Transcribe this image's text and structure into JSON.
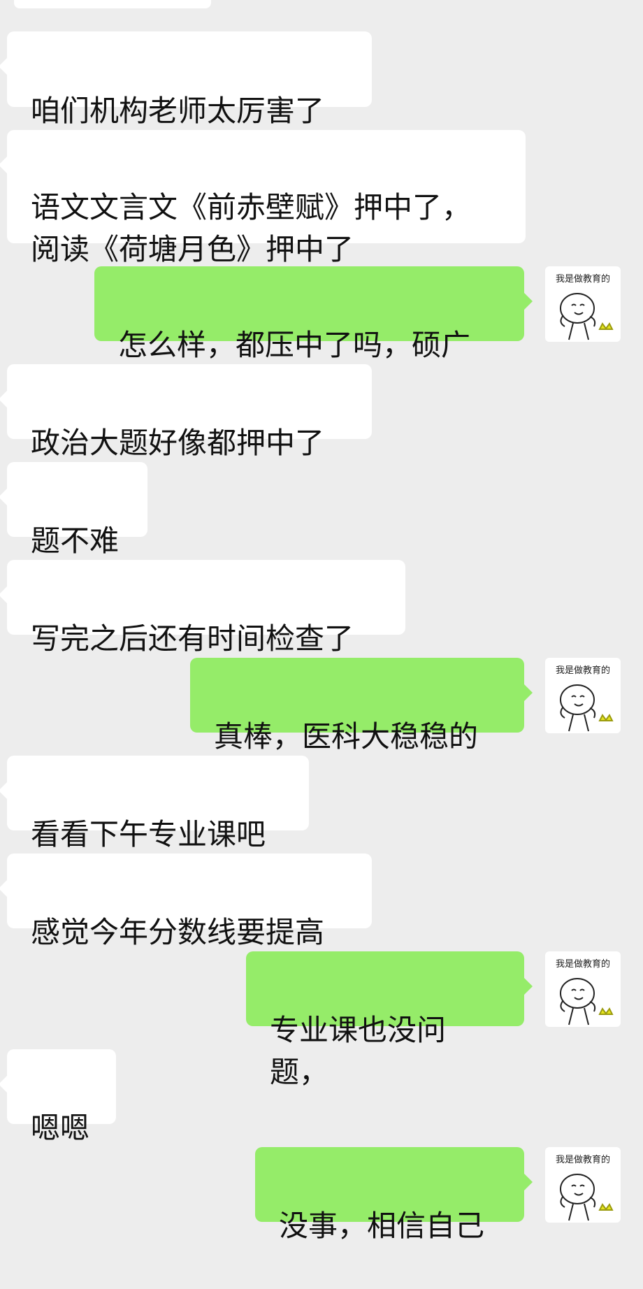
{
  "chat": {
    "messages": [
      {
        "side": "left",
        "text": "咱们机构老师太厉害了"
      },
      {
        "side": "left",
        "text": "语文文言文《前赤壁赋》押中了，\n阅读《荷塘月色》押中了"
      },
      {
        "side": "right",
        "text": "怎么样，都压中了吗，硕广"
      },
      {
        "side": "left",
        "text": "政治大题好像都押中了"
      },
      {
        "side": "left",
        "text": "题不难"
      },
      {
        "side": "left",
        "text": "写完之后还有时间检查了"
      },
      {
        "side": "right",
        "text": "真棒，医科大稳稳的"
      },
      {
        "side": "left",
        "text": "看看下午专业课吧"
      },
      {
        "side": "left",
        "text": "感觉今年分数线要提高"
      },
      {
        "side": "right",
        "text": "专业课也没问题，"
      },
      {
        "side": "left",
        "text": "嗯嗯"
      },
      {
        "side": "right",
        "text": "没事，相信自己"
      }
    ],
    "avatar_caption": "我是做教育的",
    "colors": {
      "background": "#ededed",
      "incoming_bubble": "#ffffff",
      "outgoing_bubble": "#95ec69",
      "text": "#111111"
    }
  }
}
